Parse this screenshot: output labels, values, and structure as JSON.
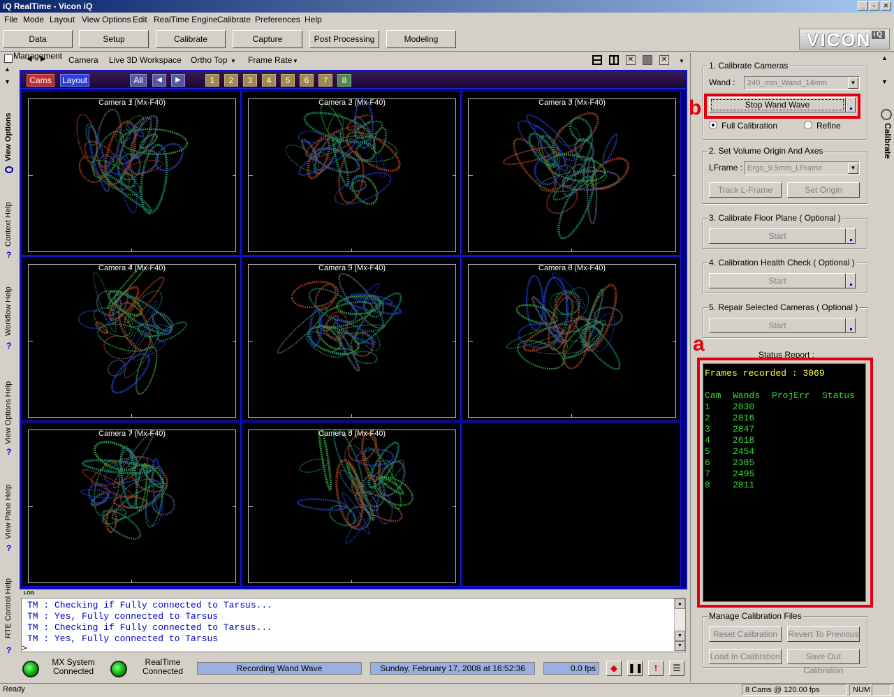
{
  "window": {
    "title": "RealTime - Vicon iQ",
    "app_badge": "iQ",
    "controls": [
      "_",
      "▫",
      "✕"
    ]
  },
  "menu": [
    "File",
    "Mode",
    "Layout",
    "View Options",
    "Edit",
    "RealTime Engine",
    "Calibrate",
    "Preferences",
    "Help"
  ],
  "tabs": [
    "Data Management",
    "Setup",
    "Calibrate",
    "Capture",
    "Post Processing",
    "Modeling"
  ],
  "logo": {
    "text": "VICON",
    "sup": "iQ"
  },
  "left_tabs": [
    "View Options",
    "Context Help",
    "Workflow Help",
    "View Options Help",
    "View Pane Help",
    "RTE Control Help"
  ],
  "view_toolbar": {
    "items": [
      "Camera",
      "Live 3D Workspace",
      "Ortho Top",
      "Frame Rate"
    ]
  },
  "camera_header": {
    "cams": "Cams",
    "layout": "Layout",
    "all": "All",
    "numbers": [
      "1",
      "2",
      "3",
      "4",
      "5",
      "6",
      "7",
      "8"
    ]
  },
  "cameras": [
    {
      "label": "Camera 1 (Mx-F40)"
    },
    {
      "label": "Camera 2 (Mx-F40)"
    },
    {
      "label": "Camera 3 (Mx-F40)"
    },
    {
      "label": "Camera 4 (Mx-F40)"
    },
    {
      "label": "Camera 5 (Mx-F40)"
    },
    {
      "label": "Camera 6 (Mx-F40)"
    },
    {
      "label": "Camera 7 (Mx-F40)"
    },
    {
      "label": "Camera 8 (Mx-F40)"
    }
  ],
  "log": {
    "header": "LOG",
    "lines": [
      "TM : Checking if Fully connected to Tarsus...",
      "TM : Yes, Fully connected to Tarsus",
      "TM : Checking if Fully connected to Tarsus...",
      "TM : Yes, Fully connected to Tarsus"
    ],
    "prompt": ">"
  },
  "bottom": {
    "mx_status": "MX System\nConnected",
    "rt_status": "RealTime\nConnected",
    "state": "Recording Wand Wave",
    "datetime": "Sunday, February 17, 2008 at 16:52:36",
    "fps": "0.0 fps"
  },
  "statusbar": {
    "left": "Ready",
    "cams": "8 Cams @ 120.00 fps",
    "num": "NUM"
  },
  "right_panel": {
    "tab_label": "Calibrate",
    "g1": {
      "title": "1. Calibrate Cameras",
      "wand_label": "Wand :",
      "wand_value": "240_mm_Wand_14mm",
      "stop_button": "Stop Wand Wave",
      "full_calibration": "Full Calibration",
      "refine": "Refine"
    },
    "g2": {
      "title": "2. Set Volume Origin And Axes",
      "lframe_label": "LFrame :",
      "lframe_value": "Ergo_9.5mm_LFrame",
      "track_button": "Track L-Frame",
      "origin_button": "Set Origin"
    },
    "g3": {
      "title": "3. Calibrate Floor Plane ( Optional )",
      "button": "Start"
    },
    "g4": {
      "title": "4. Calibration Health Check  ( Optional )",
      "button": "Start"
    },
    "g5": {
      "title": "5. Repair Selected Cameras  ( Optional )",
      "button": "Start"
    },
    "status_report": {
      "title": "Status Report :",
      "frames": "Frames recorded : 3069",
      "headers": [
        "Cam",
        "Wands",
        "ProjErr",
        "Status"
      ],
      "rows": [
        {
          "cam": "1",
          "wands": "2830"
        },
        {
          "cam": "2",
          "wands": "2816"
        },
        {
          "cam": "3",
          "wands": "2847"
        },
        {
          "cam": "4",
          "wands": "2618"
        },
        {
          "cam": "5",
          "wands": "2454"
        },
        {
          "cam": "6",
          "wands": "2385"
        },
        {
          "cam": "7",
          "wands": "2495"
        },
        {
          "cam": "8",
          "wands": "2811"
        }
      ]
    },
    "manage": {
      "title": "Manage Calibration Files",
      "reset": "Reset Calibration",
      "revert": "Revert To Previous",
      "load": "Load In Calibration",
      "save": "Save Out Calibration"
    }
  },
  "annotations": {
    "a": "a",
    "b": "b"
  },
  "colors": {
    "annotation_red": "#e00010",
    "status_yellow": "#ffff40",
    "status_green": "#30e030",
    "log_blue": "#0000cc",
    "camera_border": "#1a1ae0"
  }
}
